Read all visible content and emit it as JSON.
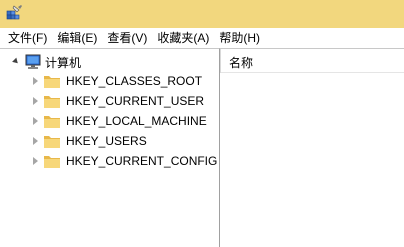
{
  "titlebar": {
    "icon": "registry-editor-icon",
    "color": "#f2d77e"
  },
  "menu": [
    {
      "label": "文件(F)"
    },
    {
      "label": "编辑(E)"
    },
    {
      "label": "查看(V)"
    },
    {
      "label": "收藏夹(A)"
    },
    {
      "label": "帮助(H)"
    }
  ],
  "tree": {
    "root": {
      "label": "计算机",
      "icon": "computer-icon",
      "expanded": true
    },
    "children": [
      {
        "label": "HKEY_CLASSES_ROOT",
        "icon": "folder-icon"
      },
      {
        "label": "HKEY_CURRENT_USER",
        "icon": "folder-icon"
      },
      {
        "label": "HKEY_LOCAL_MACHINE",
        "icon": "folder-icon"
      },
      {
        "label": "HKEY_USERS",
        "icon": "folder-icon"
      },
      {
        "label": "HKEY_CURRENT_CONFIG",
        "icon": "folder-icon"
      }
    ]
  },
  "list": {
    "columns": [
      {
        "label": "名称"
      }
    ]
  }
}
